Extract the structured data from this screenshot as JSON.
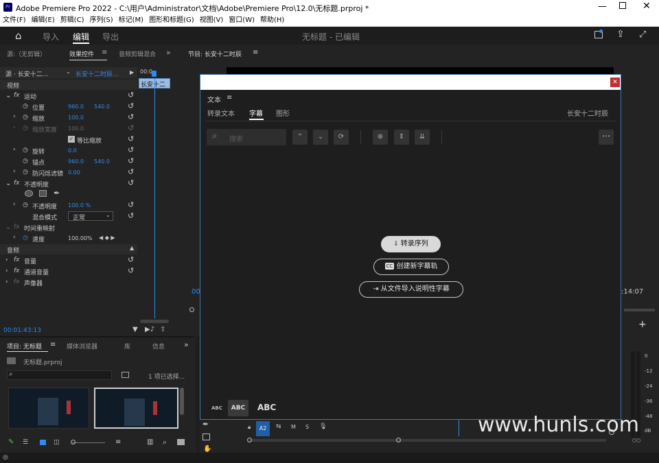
{
  "titlebar": {
    "title": "Adobe Premiere Pro 2022 - C:\\用户\\Administrator\\文档\\Adobe\\Premiere Pro\\12.0\\无标题.prproj *",
    "app_icon": "Pr"
  },
  "menu": [
    "文件(F)",
    "编辑(E)",
    "剪辑(C)",
    "序列(S)",
    "标记(M)",
    "图形和标题(G)",
    "视图(V)",
    "窗口(W)",
    "帮助(H)"
  ],
  "appbar": {
    "import": "导入",
    "edit": "编辑",
    "export": "导出",
    "doc_title": "无标题 - 已编辑"
  },
  "tabs_left": {
    "source": "源:（无剪辑）",
    "effect_controls": "效果控件",
    "audio_mixer": "音频剪辑混合",
    "program": "节目: 长安十二时辰"
  },
  "effect_controls": {
    "source_label": "源 · 长安十二...",
    "seq_label": "长安十二时辰...",
    "time_start": "00:0",
    "clip_label": "长安十二",
    "video_header": "视频",
    "motion": "运动",
    "position": "位置",
    "pos_x": "960.0",
    "pos_y": "540.0",
    "scale": "缩放",
    "scale_val": "100.0",
    "scale_width": "缩放宽度",
    "scale_width_val": "100.0",
    "uniform_scale": "等比缩放",
    "rotation": "旋转",
    "rotation_val": "0.0",
    "anchor": "锚点",
    "anchor_x": "960.0",
    "anchor_y": "540.0",
    "flicker": "防闪烁滤镜",
    "flicker_val": "0.00",
    "opacity_header": "不透明度",
    "opacity": "不透明度",
    "opacity_val": "100.0 %",
    "blend_mode": "混合模式",
    "blend_val": "正常",
    "time_remap": "时间重映射",
    "speed": "速度",
    "speed_val": "100.00%",
    "audio_header": "音频",
    "volume": "音量",
    "channel_volume": "通道音量",
    "panner": "声像器",
    "timecode": "00:01:43:13"
  },
  "project": {
    "tab_project": "项目: 无标题",
    "tab_media": "媒体浏览器",
    "tab_library": "库",
    "tab_info": "信息",
    "file": "无标题.prproj",
    "selection": "1 项已选择..."
  },
  "program": {
    "timecode_left": "00",
    "timecode_right": ":14:07"
  },
  "meters": {
    "labels": [
      "0",
      "-12",
      "-24",
      "-36",
      "-48",
      "dB"
    ]
  },
  "timeline": {
    "track": "A2",
    "m": "M",
    "s": "S"
  },
  "text_panel": {
    "title": "文本",
    "tabs": [
      "转录文本",
      "字幕",
      "图形"
    ],
    "active_tab": "字幕",
    "sequence": "长安十二时辰",
    "search_placeholder": "搜索",
    "btn_transcribe": "转录序列",
    "btn_create_track": "创建新字幕轨",
    "btn_import": "从文件导入说明性字幕",
    "cc_badge": "CC",
    "abc_small": "ABC",
    "abc_mid": "ABC",
    "abc_large": "ABC"
  },
  "watermark": "www.hunls.com"
}
